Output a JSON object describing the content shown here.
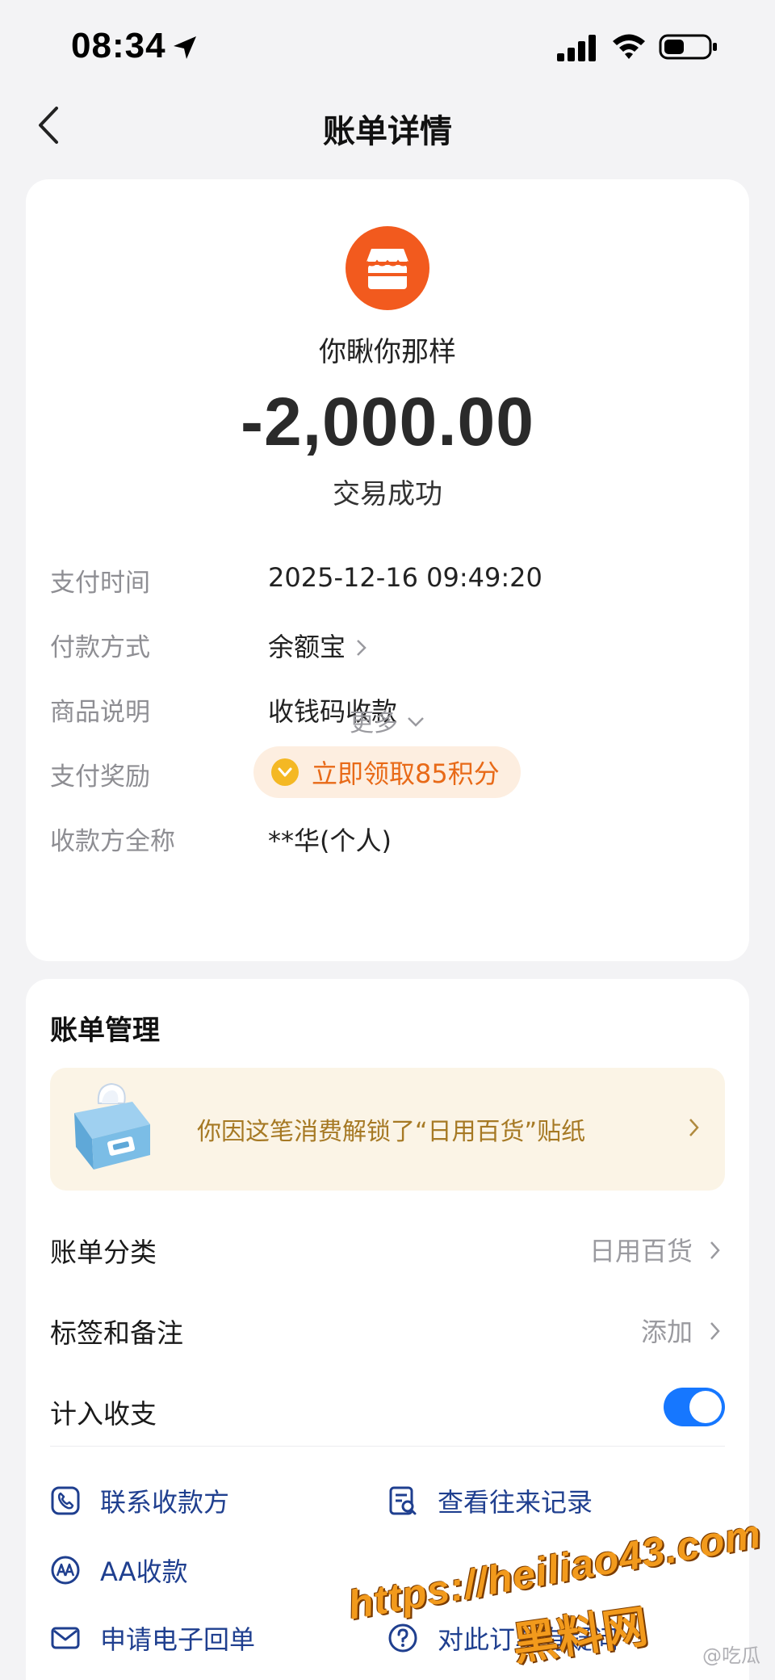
{
  "status_bar": {
    "time": "08:34"
  },
  "nav": {
    "title": "账单详情"
  },
  "bill": {
    "merchant_name": "你瞅你那样",
    "amount": "-2,000.00",
    "status": "交易成功",
    "details": [
      {
        "label": "支付时间",
        "value": "2025-12-16 09:49:20"
      },
      {
        "label": "付款方式",
        "value": "余额宝"
      },
      {
        "label": "商品说明",
        "value": "收钱码收款"
      },
      {
        "label": "支付奖励",
        "value": "立即领取85积分"
      },
      {
        "label": "收款方全称",
        "value": "**华(个人)"
      }
    ],
    "more_label": "更多"
  },
  "management": {
    "title": "账单管理",
    "sticker_text": "你因这笔消费解锁了“日用百货”贴纸",
    "rows": [
      {
        "label": "账单分类",
        "value": "日用百货"
      },
      {
        "label": "标签和备注",
        "value": "添加"
      },
      {
        "label": "计入收支",
        "toggle_on": true
      }
    ],
    "actions": [
      {
        "label": "联系收款方",
        "icon": "phone-icon"
      },
      {
        "label": "查看往来记录",
        "icon": "records-icon"
      },
      {
        "label": "AA收款",
        "icon": "aa-icon"
      },
      {
        "label": "申请电子回单",
        "icon": "mail-icon"
      },
      {
        "label": "对此订单有疑问",
        "icon": "question-icon"
      }
    ]
  },
  "watermark": {
    "url": "https://heiliao43.com",
    "site_name": "黑料网",
    "weibo": "@吃瓜"
  },
  "colors": {
    "accent_blue": "#1677ff",
    "merchant_orange": "#f25a1e",
    "reward_orange": "#e86a18",
    "action_blue": "#1f3f8f"
  }
}
